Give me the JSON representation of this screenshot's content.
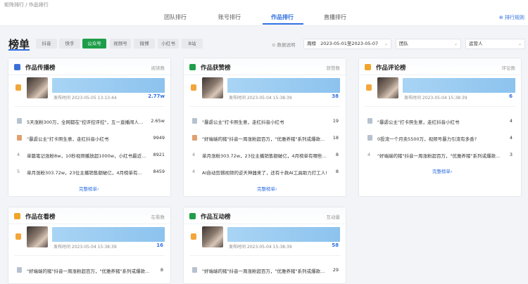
{
  "breadcrumb": "矩阵排行 / 作品排行",
  "tabs": [
    "团队排行",
    "账号排行",
    "作品排行",
    "直播排行"
  ],
  "rules_link": "⊕ 排行规则",
  "filter": {
    "title": "榜单",
    "platforms": [
      "抖音",
      "快手",
      "公众号",
      "视频号",
      "微博",
      "小红书",
      "B站"
    ],
    "explain": "⊙ 数据说明",
    "date_label": "周榜",
    "date_range": "2023-05-01至2023-05-07",
    "team": "团队",
    "operator": "运营人"
  },
  "cards": [
    {
      "title": "作品传播榜",
      "metric": "阅读数",
      "icon_color": "#3b6fd8",
      "top": {
        "time": "发布时间 2023-05-05 13:13:44",
        "value": "2.77w",
        "fill": 1.0
      },
      "rows": [
        {
          "rank": "2",
          "text": "5天涨粉300万，全网都在\"控评控评控\"，五一直播闹人最...",
          "value": "2.65w"
        },
        {
          "rank": "3",
          "text": "\"暴虐公主\"打卡照生意，走红抖音小红书",
          "value": "9949"
        },
        {
          "rank": "4",
          "text": "单篇笔记涨粉8w，10秒视频播放超1000w，小红书最近在...",
          "value": "8921"
        },
        {
          "rank": "5",
          "text": "单月涨粉303.72w，23位主播销售额破亿，4月榜单有哪些...",
          "value": "8459"
        }
      ],
      "more": "完整榜单›"
    },
    {
      "title": "作品获赞榜",
      "metric": "获赞数",
      "icon_color": "#1f9e4a",
      "top": {
        "time": "发布时间 2023-05-04 15:38:39",
        "value": "38",
        "fill": 1.0
      },
      "rows": [
        {
          "rank": "2",
          "text": "\"暴虐公主\"打卡照生意，走红抖音小红书",
          "value": "19"
        },
        {
          "rank": "3",
          "text": "\"好端端的猪\"抖音一周涨粉超百万，\"优雅养猪\"系列或爆款...",
          "value": "18"
        },
        {
          "rank": "4",
          "text": "单月涨粉303.72w，23位主播销售额破亿，4月榜单有哪些看点?",
          "value": "8"
        },
        {
          "rank": "4",
          "text": "AI自动剪辑视频的逆天神器来了，还有十款AI工具助力打工人!",
          "value": "8"
        }
      ],
      "more": "完整榜单›"
    },
    {
      "title": "作品评论榜",
      "metric": "评论数",
      "icon_color": "#f0a52a",
      "top": {
        "time": "发布时间 2023-05-04 15:38:39",
        "value": "6",
        "fill": 1.0
      },
      "rows": [
        {
          "rank": "2",
          "text": "\"暴虐公主\"打卡照生意，走红抖音小红书",
          "value": "4"
        },
        {
          "rank": "2",
          "text": "0投流一个月卖5500万，视频号暴力引流有多香?",
          "value": "4"
        },
        {
          "rank": "4",
          "text": "\"好端端的猪\"抖音一周涨粉超百万，\"优雅养猪\"系列或爆款...",
          "value": "3"
        }
      ],
      "more": "完整榜单›"
    },
    {
      "title": "作品在看榜",
      "metric": "在看数",
      "icon_color": "#f0a52a",
      "top": {
        "time": "发布时间 2023-05-04 15:38:39",
        "value": "16",
        "fill": 1.0
      },
      "rows": [
        {
          "rank": "2",
          "text": "\"好端端的猪\"抖音一周涨粉超百万，\"优雅养猪\"系列或爆款...",
          "value": "8"
        }
      ],
      "more": ""
    },
    {
      "title": "作品互动榜",
      "metric": "互动量",
      "icon_color": "#1f9e4a",
      "top": {
        "time": "发布时间 2023-05-04 15:38:39",
        "value": "58",
        "fill": 1.0
      },
      "rows": [
        {
          "rank": "2",
          "text": "\"好端端的猪\"抖音一周涨粉超百万，\"优雅养猪\"系列或爆款...",
          "value": "29"
        }
      ],
      "more": ""
    }
  ]
}
